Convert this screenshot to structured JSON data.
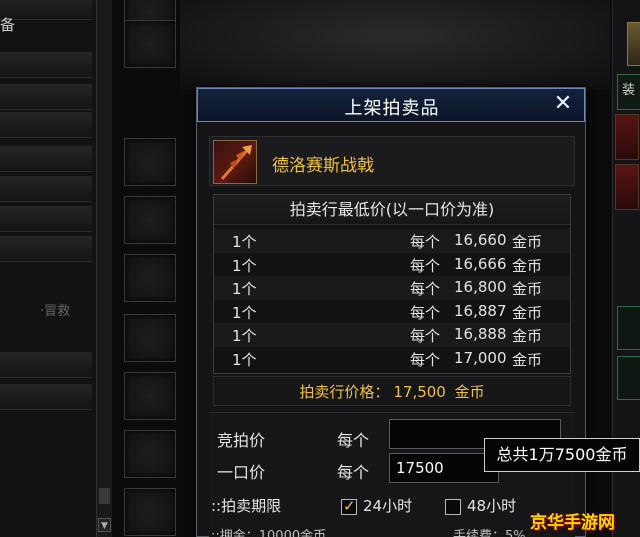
{
  "background": {
    "left_partial_text": "备",
    "middle_partial_text": "·冒救",
    "right_partial_tab": "装"
  },
  "dialog": {
    "title": "上架拍卖品",
    "close_label": "✕",
    "item": {
      "name": "德洛赛斯战戟"
    },
    "lowest_price": {
      "header": "拍卖行最低价(以一口价为准)",
      "rows": [
        {
          "qty": "1个",
          "per": "每个",
          "amount": "16,660",
          "currency": "金币"
        },
        {
          "qty": "1个",
          "per": "每个",
          "amount": "16,666",
          "currency": "金币"
        },
        {
          "qty": "1个",
          "per": "每个",
          "amount": "16,800",
          "currency": "金币"
        },
        {
          "qty": "1个",
          "per": "每个",
          "amount": "16,887",
          "currency": "金币"
        },
        {
          "qty": "1个",
          "per": "每个",
          "amount": "16,888",
          "currency": "金币"
        },
        {
          "qty": "1个",
          "per": "每个",
          "amount": "17,000",
          "currency": "金币"
        }
      ]
    },
    "auction_price": {
      "label": "拍卖行价格：",
      "amount": "17,500",
      "currency": "金币"
    },
    "form": {
      "bid_label": "竞拍价",
      "bid_per": "每个",
      "bid_value": "",
      "buyout_label": "一口价",
      "buyout_per": "每个",
      "buyout_value": "17500",
      "duration_label": "::拍卖期限",
      "option_24h": "24小时",
      "option_48h": "48小时",
      "deposit_partial": "::押金：10000金币",
      "fee_partial": "手续费：5%"
    },
    "tooltip": "总共1万7500金币"
  },
  "watermark": "京华手游网",
  "colors": {
    "gold_text": "#f0c040",
    "title_bar": "#0b1528",
    "title_border": "#6f86b4"
  },
  "icons": [
    "close-icon",
    "halberd-icon",
    "checkbox-checked-icon",
    "checkbox-empty-icon"
  ]
}
